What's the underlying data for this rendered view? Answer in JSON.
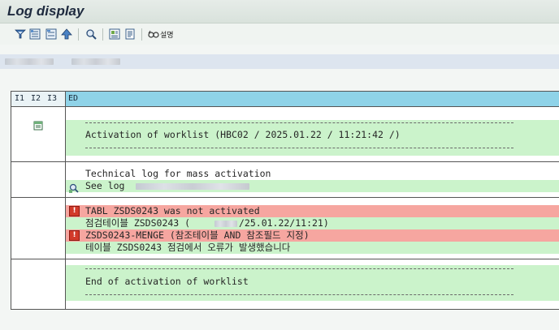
{
  "window": {
    "title": "Log display"
  },
  "toolbar": {
    "icons": [
      "filter-icon",
      "expand-icon",
      "collapse-icon",
      "up-icon",
      "find-icon",
      "layout-icon",
      "print-icon",
      "help-glasses-icon"
    ],
    "help_label": "설명"
  },
  "log": {
    "header": [
      "I1",
      "I2",
      "I3",
      "ED"
    ],
    "blocks": [
      {
        "lines": [
          "Activation of worklist (HBC02 / 2025.01.22 / 11:21:42 /)"
        ]
      },
      {
        "lines": [
          "Technical log for mass activation",
          "See log"
        ]
      },
      {
        "lines": [
          "TABL ZSDS0243 was not activated",
          "점검테이블 ZSDS0243 (",
          "/25.01.22/11:21)",
          "ZSDS0243-MENGE (참조테이블 AND 참조필드 지정)",
          "테이블 ZSDS0243 점검에서 오류가 발생했습니다"
        ]
      },
      {
        "lines": [
          "End of activation of worklist"
        ]
      }
    ]
  },
  "colors": {
    "success_band": "#cbf3cb",
    "error_band": "#f6a6a0",
    "header_band": "#8fd3e8"
  }
}
